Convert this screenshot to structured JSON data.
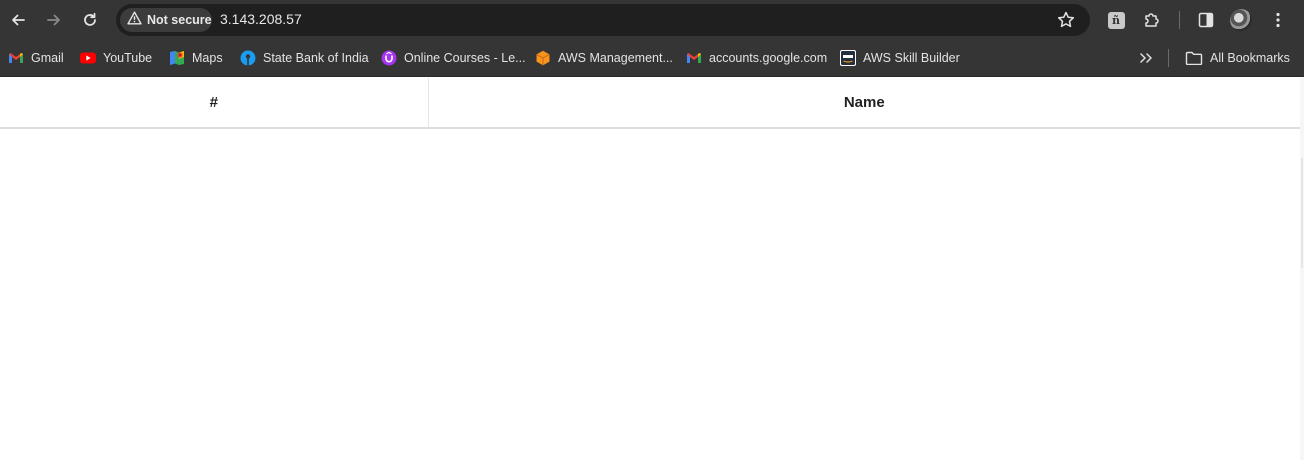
{
  "toolbar": {
    "security_label": "Not secure",
    "url": "3.143.208.57",
    "icons": [
      "back-icon",
      "forward-icon",
      "reload-icon",
      "warning-icon",
      "star-icon",
      "extension-badge-icon",
      "puzzle-icon",
      "side-panel-icon",
      "profile-avatar",
      "more-vert-icon"
    ],
    "extension_badge_glyph": "ñ"
  },
  "bookmarks": {
    "items": [
      {
        "label": "Gmail",
        "icon": "gmail-icon"
      },
      {
        "label": "YouTube",
        "icon": "youtube-icon"
      },
      {
        "label": "Maps",
        "icon": "maps-icon"
      },
      {
        "label": "State Bank of India",
        "icon": "sbi-icon"
      },
      {
        "label": "Online Courses - Le...",
        "icon": "udemy-icon"
      },
      {
        "label": "AWS Management...",
        "icon": "aws-cube-icon"
      },
      {
        "label": "accounts.google.com",
        "icon": "gmail-icon"
      },
      {
        "label": "AWS Skill Builder",
        "icon": "aws-icon"
      }
    ],
    "overflow_icon": "chevron-double-right-icon",
    "all_bookmarks_label": "All Bookmarks"
  },
  "table": {
    "headers": [
      "#",
      "Name"
    ],
    "rows": []
  },
  "colors": {
    "chrome_bg": "#353535",
    "omnibox_bg": "#1f1f1f",
    "page_bg": "#ffffff",
    "youtube_red": "#ff0000",
    "sbi_blue": "#1a9cf0",
    "udemy_purple": "#a435f0",
    "aws_orange": "#f7941d"
  }
}
